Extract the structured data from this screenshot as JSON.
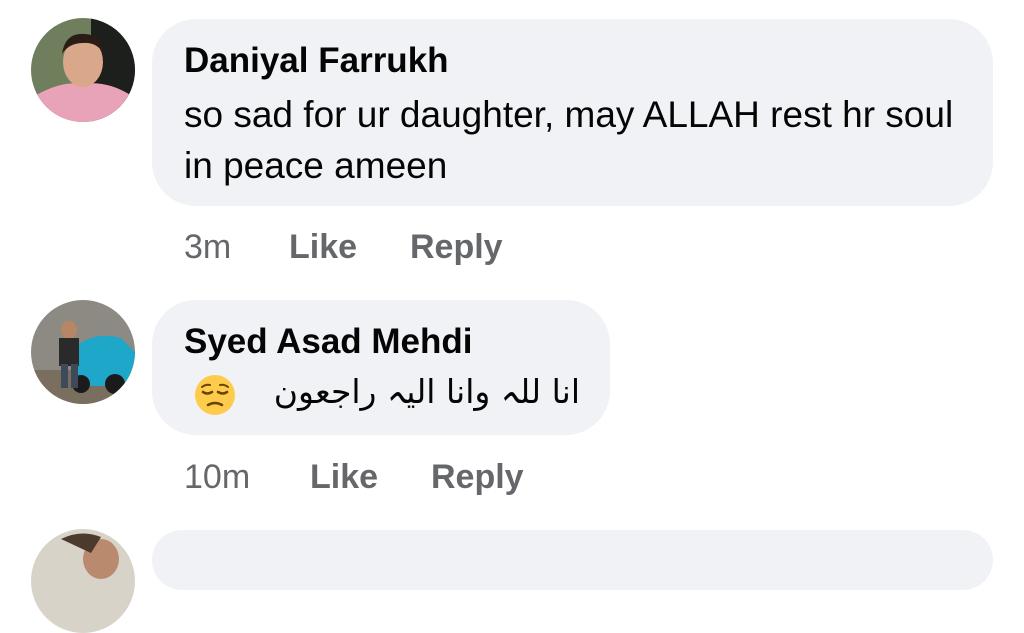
{
  "comments": [
    {
      "author": "Daniyal Farrukh",
      "text": "so sad for ur daughter, may ALLAH rest hr soul in peace ameen",
      "time": "3m",
      "like": "Like",
      "reply": "Reply"
    },
    {
      "author": "Syed Asad Mehdi",
      "text": "انا للہ وانا الیہ راجعون",
      "emoji": "pensive-face-emoji",
      "time": "10m",
      "like": "Like",
      "reply": "Reply"
    }
  ],
  "colors": {
    "bubble": "#f0f2f5",
    "meta": "#65676b",
    "text": "#050505"
  }
}
